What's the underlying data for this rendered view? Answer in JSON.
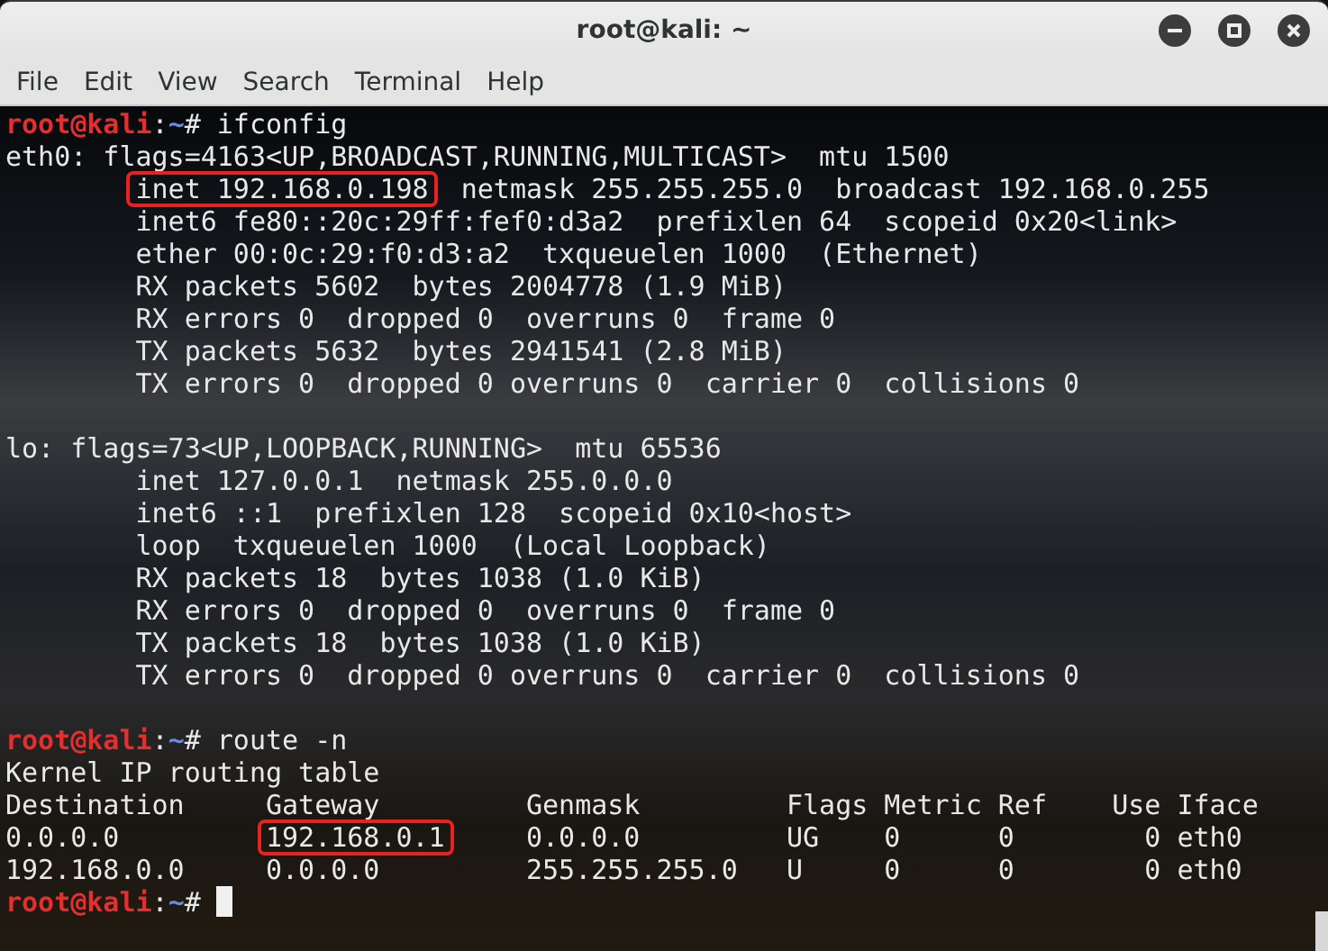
{
  "window": {
    "title": "root@kali: ~"
  },
  "menu": [
    "File",
    "Edit",
    "View",
    "Search",
    "Terminal",
    "Help"
  ],
  "terminal": {
    "lines": [
      {
        "kind": "prompt",
        "user": "root@kali",
        "sep": ":",
        "path": "~",
        "mark": "#",
        "command": " ifconfig",
        "cursor": false
      },
      {
        "kind": "output",
        "segments": [
          {
            "kind": "plain",
            "text": "eth0: flags=4163<UP,BROADCAST,RUNNING,MULTICAST>  mtu 1500"
          }
        ]
      },
      {
        "kind": "output",
        "indent": true,
        "segments": [
          {
            "kind": "boxed",
            "text": "inet 192.168.0.198"
          },
          {
            "kind": "plain",
            "text": "  netmask 255.255.255.0  broadcast 192.168.0.255"
          }
        ]
      },
      {
        "kind": "output",
        "segments": [
          {
            "kind": "plain",
            "text": "        inet6 fe80::20c:29ff:fef0:d3a2  prefixlen 64  scopeid 0x20<link>"
          }
        ]
      },
      {
        "kind": "output",
        "segments": [
          {
            "kind": "plain",
            "text": "        ether 00:0c:29:f0:d3:a2  txqueuelen 1000  (Ethernet)"
          }
        ]
      },
      {
        "kind": "output",
        "segments": [
          {
            "kind": "plain",
            "text": "        RX packets 5602  bytes 2004778 (1.9 MiB)"
          }
        ]
      },
      {
        "kind": "output",
        "segments": [
          {
            "kind": "plain",
            "text": "        RX errors 0  dropped 0  overruns 0  frame 0"
          }
        ]
      },
      {
        "kind": "output",
        "segments": [
          {
            "kind": "plain",
            "text": "        TX packets 5632  bytes 2941541 (2.8 MiB)"
          }
        ]
      },
      {
        "kind": "output",
        "segments": [
          {
            "kind": "plain",
            "text": "        TX errors 0  dropped 0 overruns 0  carrier 0  collisions 0"
          }
        ]
      },
      {
        "kind": "blank"
      },
      {
        "kind": "output",
        "segments": [
          {
            "kind": "plain",
            "text": "lo: flags=73<UP,LOOPBACK,RUNNING>  mtu 65536"
          }
        ]
      },
      {
        "kind": "output",
        "segments": [
          {
            "kind": "plain",
            "text": "        inet 127.0.0.1  netmask 255.0.0.0"
          }
        ]
      },
      {
        "kind": "output",
        "segments": [
          {
            "kind": "plain",
            "text": "        inet6 ::1  prefixlen 128  scopeid 0x10<host>"
          }
        ]
      },
      {
        "kind": "output",
        "segments": [
          {
            "kind": "plain",
            "text": "        loop  txqueuelen 1000  (Local Loopback)"
          }
        ]
      },
      {
        "kind": "output",
        "segments": [
          {
            "kind": "plain",
            "text": "        RX packets 18  bytes 1038 (1.0 KiB)"
          }
        ]
      },
      {
        "kind": "output",
        "segments": [
          {
            "kind": "plain",
            "text": "        RX errors 0  dropped 0  overruns 0  frame 0"
          }
        ]
      },
      {
        "kind": "output",
        "segments": [
          {
            "kind": "plain",
            "text": "        TX packets 18  bytes 1038 (1.0 KiB)"
          }
        ]
      },
      {
        "kind": "output",
        "segments": [
          {
            "kind": "plain",
            "text": "        TX errors 0  dropped 0 overruns 0  carrier 0  collisions 0"
          }
        ]
      },
      {
        "kind": "blank"
      },
      {
        "kind": "prompt",
        "user": "root@kali",
        "sep": ":",
        "path": "~",
        "mark": "#",
        "command": " route -n",
        "cursor": false
      },
      {
        "kind": "output",
        "segments": [
          {
            "kind": "plain",
            "text": "Kernel IP routing table"
          }
        ]
      },
      {
        "kind": "output",
        "segments": [
          {
            "kind": "plain",
            "text": "Destination     Gateway         Genmask         Flags Metric Ref    Use Iface"
          }
        ]
      },
      {
        "kind": "output",
        "segments": [
          {
            "kind": "plain",
            "text": "0.0.0.0         "
          },
          {
            "kind": "boxed",
            "text": "192.168.0.1"
          },
          {
            "kind": "plain",
            "text": "     0.0.0.0         UG    0      0        0 eth0"
          }
        ]
      },
      {
        "kind": "output",
        "segments": [
          {
            "kind": "plain",
            "text": "192.168.0.0     0.0.0.0         255.255.255.0   U     0      0        0 eth0"
          }
        ]
      },
      {
        "kind": "prompt",
        "user": "root@kali",
        "sep": ":",
        "path": "~",
        "mark": "#",
        "cursor": true
      }
    ]
  }
}
